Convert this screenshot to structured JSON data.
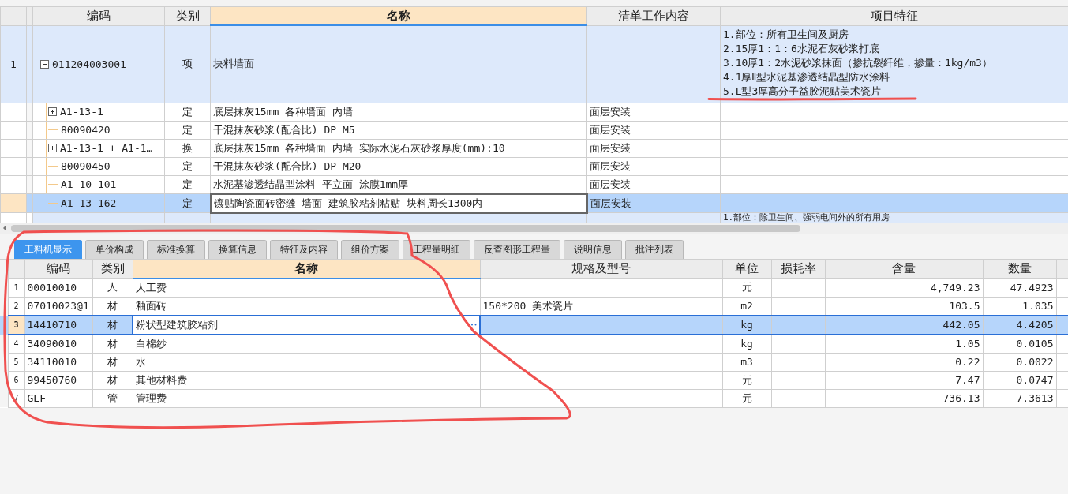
{
  "upper_table": {
    "columns": [
      "编码",
      "类别",
      "名称",
      "清单工作内容",
      "项目特征"
    ],
    "rows": [
      {
        "row_number": "1",
        "code": "011204003001",
        "expanded": true,
        "type": "项",
        "name": "块料墙面",
        "work_content": "",
        "selected": false,
        "features": [
          "1.部位：所有卫生间及厨房",
          "2.15厚1：1：6水泥石灰砂浆打底",
          "3.10厚1：2水泥砂浆抹面（掺抗裂纤维，掺量：1kg/m3）",
          "4.1厚Ⅱ型水泥基渗透结晶型防水涂料",
          "5.L型3厚高分子益胶泥贴美术瓷片"
        ],
        "children": [
          {
            "kind": "collapsible",
            "code": "A1-13-1",
            "type": "定",
            "name": "底层抹灰15mm 各种墙面 内墙",
            "work_content": "面层安装",
            "selected": false
          },
          {
            "kind": "leaf",
            "code": "80090420",
            "type": "定",
            "name": "干混抹灰砂浆(配合比) DP M5",
            "work_content": "面层安装",
            "selected": false
          },
          {
            "kind": "collapsible",
            "code": "A1-13-1 + A1-1…",
            "type": "换",
            "name": "底层抹灰15mm 各种墙面 内墙  实际水泥石灰砂浆厚度(mm):10",
            "work_content": "面层安装",
            "selected": false
          },
          {
            "kind": "leaf",
            "code": "80090450",
            "type": "定",
            "name": "干混抹灰砂浆(配合比) DP M20",
            "work_content": "面层安装",
            "selected": false
          },
          {
            "kind": "leaf",
            "code": "A1-10-101",
            "type": "定",
            "name": "水泥基渗透结晶型涂料 平立面 涂膜1mm厚",
            "work_content": "面层安装",
            "selected": false
          },
          {
            "kind": "leaf",
            "code": "A1-13-162",
            "type": "定",
            "name": "镶贴陶瓷面砖密缝 墙面 建筑胶粘剂粘贴 块料周长1300内",
            "work_content": "面层安装",
            "selected": true
          }
        ]
      }
    ],
    "next_row_features": "1.部位：除卫生间、强弱电间外的所有用房"
  },
  "tabs": [
    {
      "label": "工料机显示",
      "selected": true
    },
    {
      "label": "单价构成",
      "selected": false
    },
    {
      "label": "标准换算",
      "selected": false
    },
    {
      "label": "换算信息",
      "selected": false
    },
    {
      "label": "特征及内容",
      "selected": false
    },
    {
      "label": "组价方案",
      "selected": false
    },
    {
      "label": "工程量明细",
      "selected": false
    },
    {
      "label": "反查图形工程量",
      "selected": false
    },
    {
      "label": "说明信息",
      "selected": false
    },
    {
      "label": "批注列表",
      "selected": false
    }
  ],
  "lower_table": {
    "columns": [
      "编码",
      "类别",
      "名称",
      "规格及型号",
      "单位",
      "损耗率",
      "含量",
      "数量"
    ],
    "rows": [
      {
        "row_number": "1",
        "code": "00010010",
        "type": "人",
        "name": "人工费",
        "spec": "",
        "unit": "元",
        "loss_rate": "",
        "content": "4,749.23",
        "quantity": "47.4923",
        "selected": false
      },
      {
        "row_number": "2",
        "code": "07010023@1",
        "type": "材",
        "name": "釉面砖",
        "spec": "150*200 美术瓷片",
        "unit": "m2",
        "loss_rate": "",
        "content": "103.5",
        "quantity": "1.035",
        "selected": false
      },
      {
        "row_number": "3",
        "code": "14410710",
        "type": "材",
        "name": "粉状型建筑胶粘剂",
        "spec": "",
        "unit": "kg",
        "loss_rate": "",
        "content": "442.05",
        "quantity": "4.4205",
        "selected": true
      },
      {
        "row_number": "4",
        "code": "34090010",
        "type": "材",
        "name": "白棉纱",
        "spec": "",
        "unit": "kg",
        "loss_rate": "",
        "content": "1.05",
        "quantity": "0.0105",
        "selected": false
      },
      {
        "row_number": "5",
        "code": "34110010",
        "type": "材",
        "name": "水",
        "spec": "",
        "unit": "m3",
        "loss_rate": "",
        "content": "0.22",
        "quantity": "0.0022",
        "selected": false
      },
      {
        "row_number": "6",
        "code": "99450760",
        "type": "材",
        "name": "其他材料费",
        "spec": "",
        "unit": "元",
        "loss_rate": "",
        "content": "7.47",
        "quantity": "0.0747",
        "selected": false
      },
      {
        "row_number": "7",
        "code": "GLF",
        "type": "管",
        "name": "管理费",
        "spec": "",
        "unit": "元",
        "loss_rate": "",
        "content": "736.13",
        "quantity": "7.3613",
        "selected": false
      }
    ]
  }
}
